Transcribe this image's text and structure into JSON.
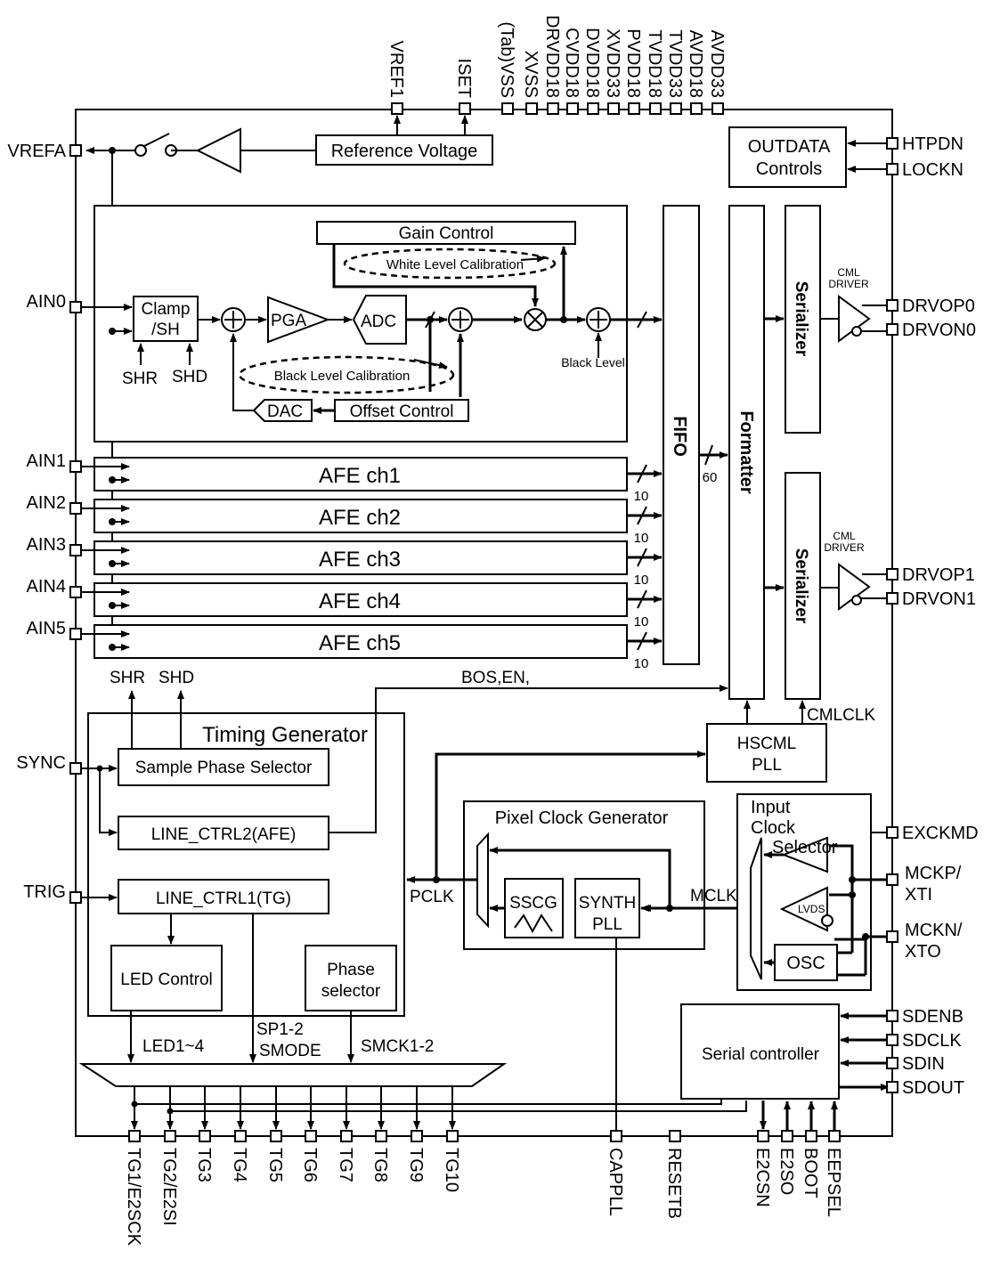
{
  "pins": {
    "top": [
      "VREF1",
      "ISET",
      "(Tab)VSS",
      "XVSS",
      "DRVDD18",
      "CVDD18",
      "DVDD18",
      "XVDD33",
      "PVDD18",
      "TVDD18",
      "TVDD33",
      "AVDD18",
      "AVDD33"
    ],
    "left": [
      "VREFA",
      "AIN0",
      "AIN1",
      "AIN2",
      "AIN3",
      "AIN4",
      "AIN5",
      "SYNC",
      "TRIG"
    ],
    "right": [
      "HTPDN",
      "LOCKN",
      "DRVOP0",
      "DRVON0",
      "DRVOP1",
      "DRVON1",
      "EXCKMD",
      "MCKP/\nXTI",
      "MCKN/\nXTO",
      "SDENB",
      "SDCLK",
      "SDIN",
      "SDOUT"
    ],
    "bottom": [
      "TG1/E2SCK",
      "TG2/E2SI",
      "TG3",
      "TG4",
      "TG5",
      "TG6",
      "TG7",
      "TG8",
      "TG9",
      "TG10",
      "CAPPLL",
      "RESETB",
      "E2CSN",
      "E2SO",
      "BOOT",
      "EEPSEL"
    ]
  },
  "blocks": {
    "reference_voltage": "Reference Voltage",
    "outdata_1": "OUTDATA",
    "outdata_2": "Controls",
    "gain_control": "Gain Control",
    "white_level": "White Level Calibration",
    "clamp_1": "Clamp",
    "clamp_2": "/SH",
    "pga": "PGA",
    "adc": "ADC",
    "black_level_cal": "Black Level Calibration",
    "black_level": "Black Level",
    "dac": "DAC",
    "offset_control": "Offset Control",
    "shr": "SHR",
    "shd": "SHD",
    "fifo": "FIFO",
    "formatter": "Formatter",
    "serializer": "Serializer",
    "cml_driver_1": "CML",
    "cml_driver_2": "DRIVER",
    "afe": [
      "AFE ch1",
      "AFE ch2",
      "AFE ch3",
      "AFE ch4",
      "AFE ch5"
    ],
    "bus_width_10": "10",
    "bus_width_60": "60",
    "bos_en": "BOS,EN,",
    "timing_generator": "Timing Generator",
    "sample_phase_selector": "Sample Phase Selector",
    "line_ctrl2": "LINE_CTRL2(AFE)",
    "line_ctrl1": "LINE_CTRL1(TG)",
    "led_control": "LED Control",
    "phase_selector_1": "Phase",
    "phase_selector_2": "selector",
    "led1_4": "LED1~4",
    "sp1_2": "SP1-2",
    "smode": "SMODE",
    "smck1_2": "SMCK1-2",
    "hscml_1": "HSCML",
    "hscml_2": "PLL",
    "cmlclk": "CMLCLK",
    "pixel_clock_generator": "Pixel Clock Generator",
    "pclk": "PCLK",
    "mclk": "MCLK",
    "sscg": "SSCG",
    "synth_1": "SYNTH",
    "synth_2": "PLL",
    "input_clock_1": "Input",
    "input_clock_2": "Clock",
    "input_clock_3": "Selector",
    "lvds": "LVDS",
    "osc": "OSC",
    "serial_controller": "Serial controller"
  }
}
